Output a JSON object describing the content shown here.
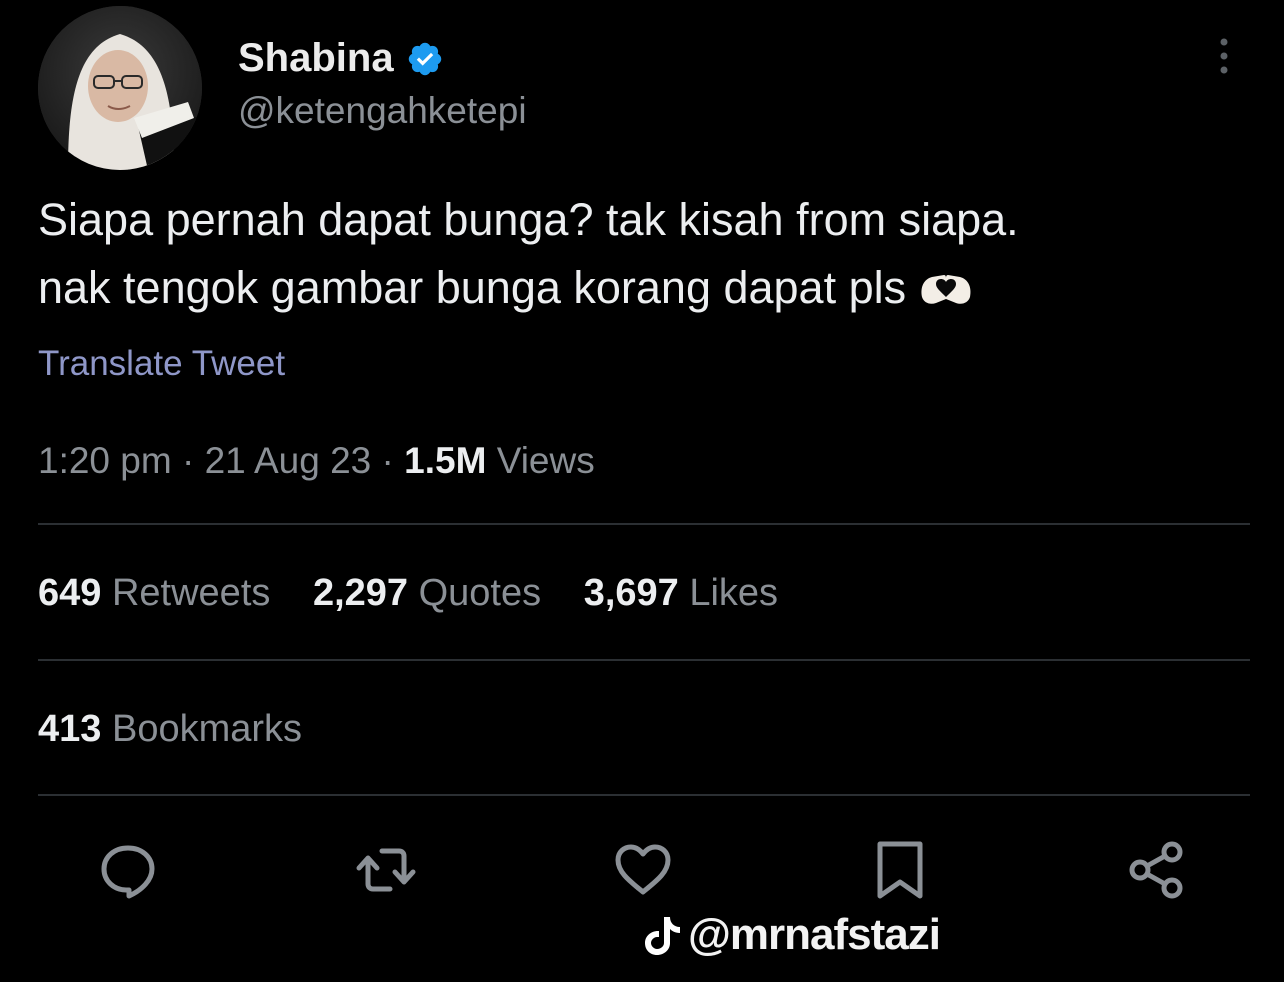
{
  "tweet": {
    "author": {
      "display_name": "Shabina",
      "handle": "@ketengahketepi",
      "verified": true
    },
    "text_lines": [
      "Siapa pernah dapat bunga? tak kisah from siapa.",
      "nak tengok gambar bunga korang dapat pls"
    ],
    "emoji": "heart-hands-icon",
    "translate_label": "Translate Tweet",
    "meta": {
      "time": "1:20 pm",
      "date": "21 Aug 23",
      "views_count": "1.5M",
      "views_label": "Views",
      "separator": "·"
    },
    "stats": {
      "retweets_count": "649",
      "retweets_label": "Retweets",
      "quotes_count": "2,297",
      "quotes_label": "Quotes",
      "likes_count": "3,697",
      "likes_label": "Likes"
    },
    "bookmarks": {
      "count": "413",
      "label": "Bookmarks"
    }
  },
  "actions": [
    "reply-icon",
    "retweet-icon",
    "like-icon",
    "bookmark-icon",
    "share-icon"
  ],
  "watermark": {
    "text": "@mrnafstazi",
    "icon": "tiktok-icon"
  },
  "colors": {
    "background": "#000000",
    "text_primary": "#eceef0",
    "text_secondary": "#8b9096",
    "translate_link": "#8f97c8",
    "verified_badge": "#1d9bf0",
    "divider": "#2b2f33"
  }
}
